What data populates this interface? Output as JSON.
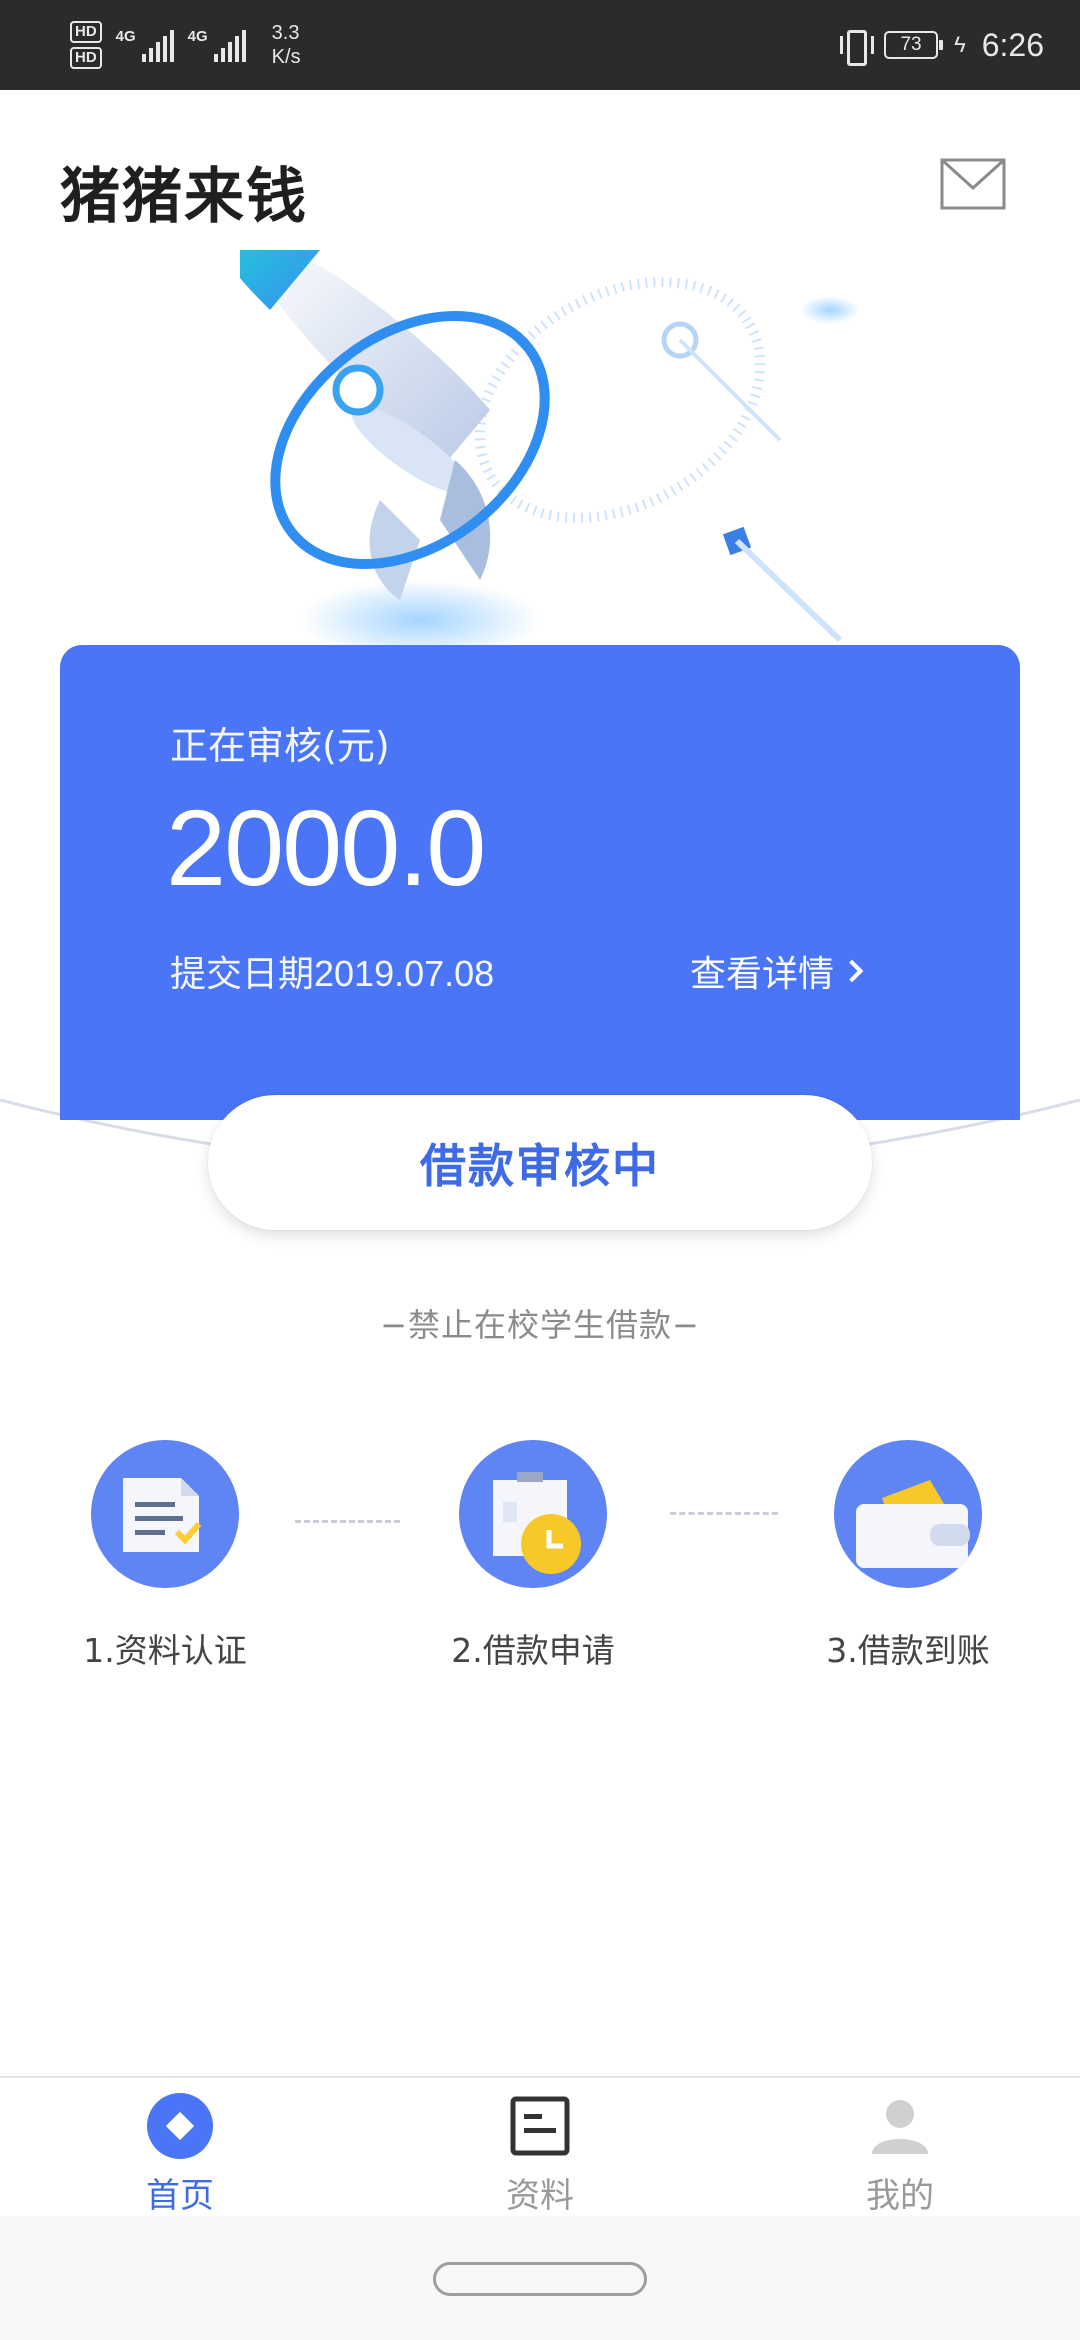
{
  "status_bar": {
    "hd1": "HD",
    "hd2": "HD",
    "sim1_net": "4G",
    "sim2_net": "4G",
    "speed_value": "3.3",
    "speed_unit": "K/s",
    "battery": "73",
    "time": "6:26"
  },
  "header": {
    "title": "猪猪来钱",
    "mail_icon": "mail-icon"
  },
  "card": {
    "label": "正在审核(元)",
    "amount": "2000.0",
    "date_label": "提交日期",
    "date_value": "2019.07.08",
    "detail_link": "查看详情",
    "background": "#4a75f6"
  },
  "status_pill": "借款审核中",
  "notice": "−禁止在校学生借款−",
  "steps": [
    {
      "label": "1.资料认证",
      "icon": "document-check-icon"
    },
    {
      "label": "2.借款申请",
      "icon": "clipboard-clock-icon"
    },
    {
      "label": "3.借款到账",
      "icon": "wallet-icon"
    }
  ],
  "nav": {
    "items": [
      {
        "label": "首页",
        "icon": "home-diamond-icon",
        "active": true
      },
      {
        "label": "资料",
        "icon": "document-icon",
        "active": false
      },
      {
        "label": "我的",
        "icon": "person-icon",
        "active": false
      }
    ],
    "active_color": "#3f6ae6",
    "inactive_color": "#999999"
  }
}
